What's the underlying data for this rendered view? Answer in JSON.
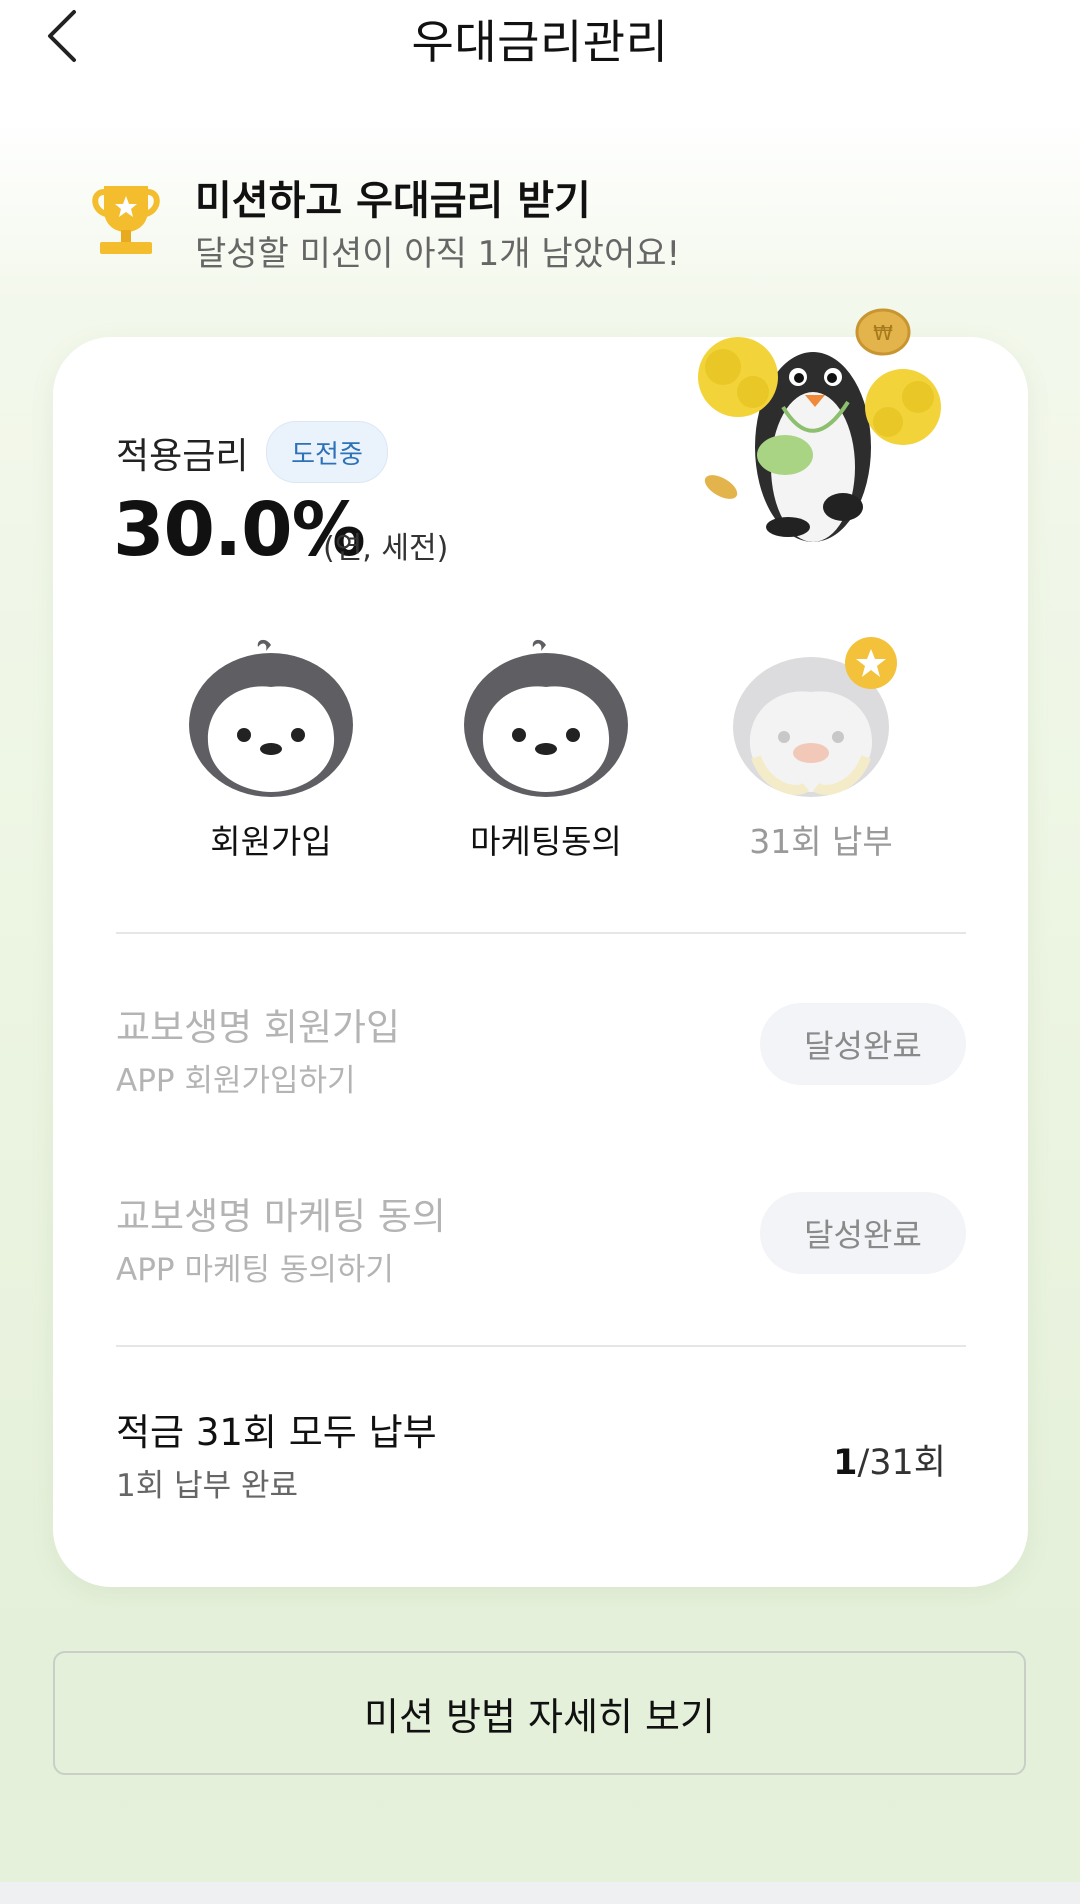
{
  "header": {
    "title": "우대금리관리",
    "back_icon": "chevron-left-icon"
  },
  "banner": {
    "icon": "trophy-icon",
    "title": "미션하고 우대금리 받기",
    "subtitle": "달성할 미션이 아직 1개 남았어요!"
  },
  "rate": {
    "label": "적용금리",
    "badge": "도전중",
    "value": "30.0%",
    "unit": "(연, 세전)"
  },
  "stamps": [
    {
      "label": "회원가입",
      "achieved": true
    },
    {
      "label": "마케팅동의",
      "achieved": true
    },
    {
      "label": "31회 납부",
      "achieved": false
    }
  ],
  "missions": [
    {
      "title": "교보생명 회원가입",
      "subtitle": "APP 회원가입하기",
      "status": "달성완료"
    },
    {
      "title": "교보생명 마케팅 동의",
      "subtitle": "APP 마케팅 동의하기",
      "status": "달성완료"
    },
    {
      "title": "적금 31회 모두 납부",
      "subtitle": "1회 납부 완료",
      "progress_current": "1",
      "progress_total": "/31회"
    }
  ],
  "detail_button": "미션 방법 자세히 보기",
  "colors": {
    "accent_blue": "#2d72b8",
    "trophy_gold": "#f3bd2e",
    "bg_green": "#e6f1dc"
  }
}
